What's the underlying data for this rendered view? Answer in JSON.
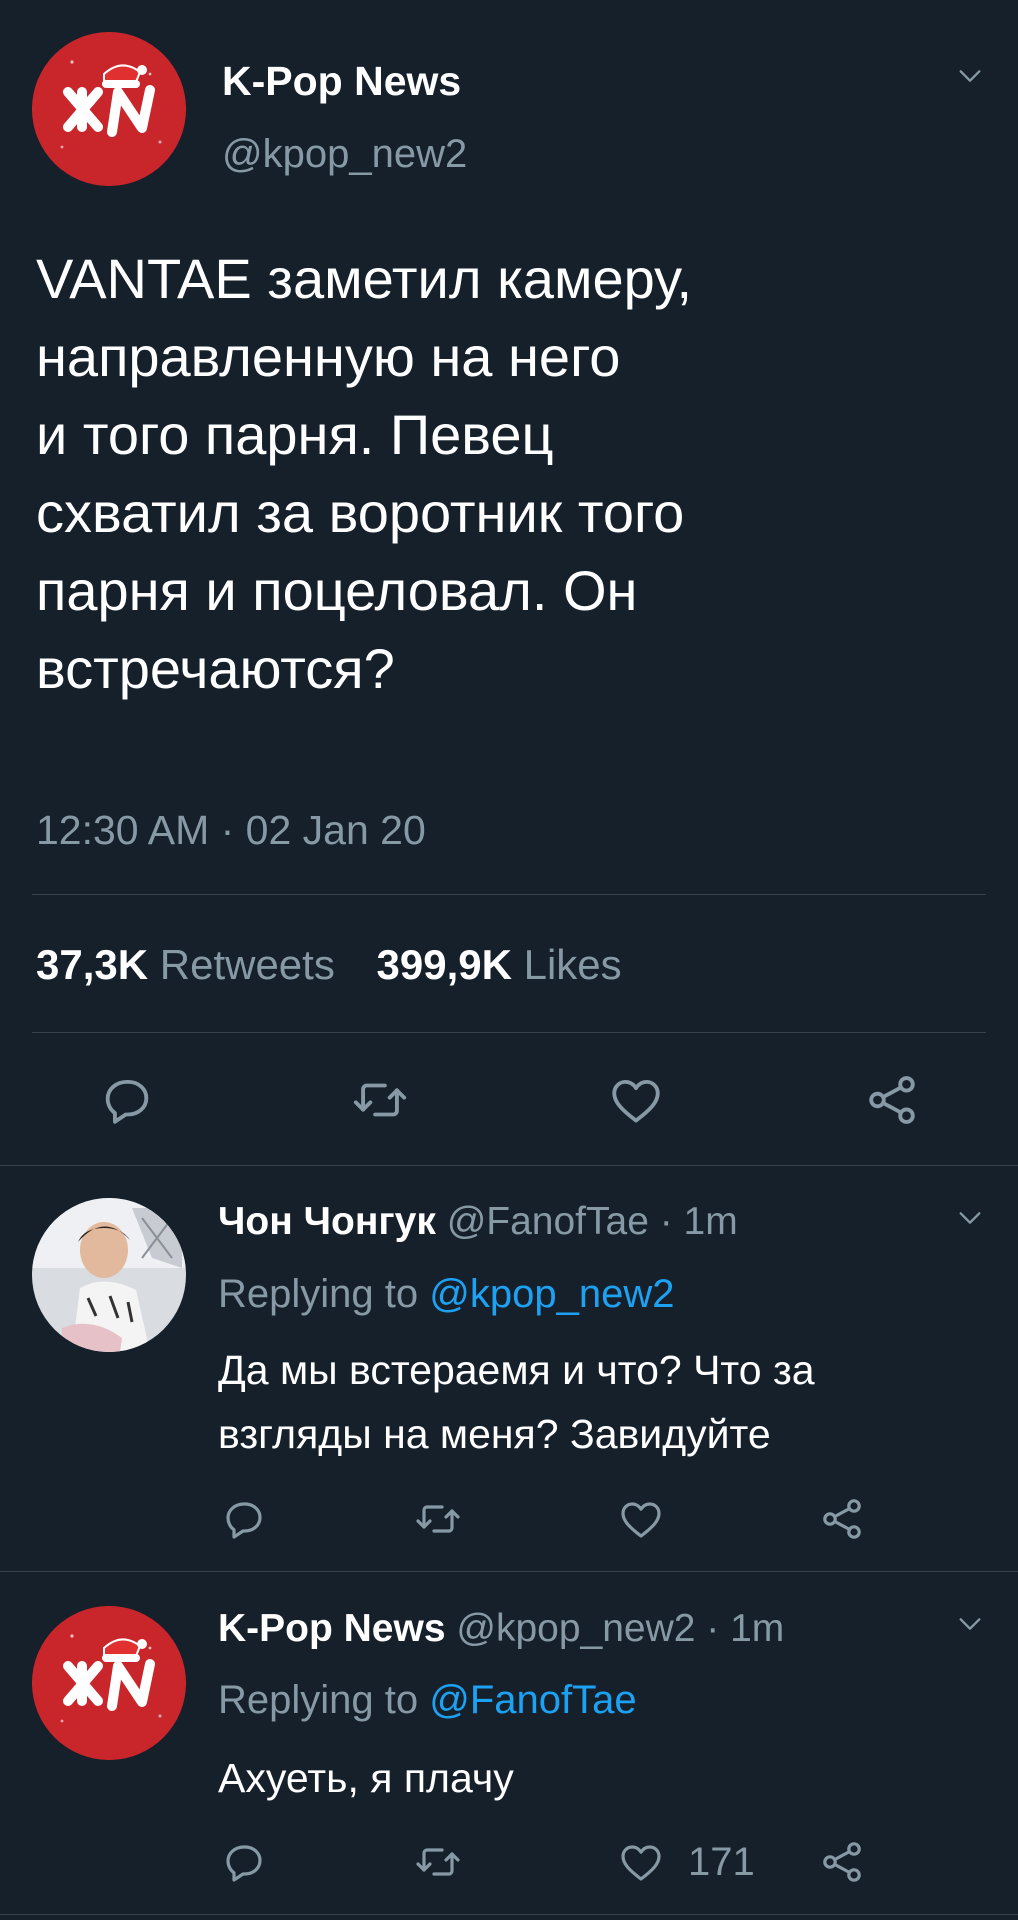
{
  "main_tweet": {
    "author_name": "K-Pop News",
    "author_handle": "@kpop_new2",
    "text_lines": [
      "VANTAE заметил камеру,",
      "направленную на него",
      "и того парня. Певец",
      "схватил за воротник того",
      "парня и поцеловал. Он",
      "встречаются?"
    ],
    "timestamp": "12:30 AM · 02 Jan 20",
    "retweets_count": "37,3K",
    "retweets_label": "Retweets",
    "likes_count": "399,9K",
    "likes_label": "Likes"
  },
  "replies": [
    {
      "author_name": "Чон Чонгук",
      "meta": "@FanofTae · 1m",
      "replying_prefix": "Replying to ",
      "replying_to": "@kpop_new2",
      "text_lines": [
        "Да мы встераемя и что? Что за",
        "взгляды на меня? Завидуйте"
      ]
    },
    {
      "author_name": "K-Pop News",
      "meta": "@kpop_new2 · 1m",
      "replying_prefix": "Replying to ",
      "replying_to": "@FanofTae",
      "text_lines": [
        "Ахуеть, я плачу"
      ],
      "like_count": "171"
    }
  ],
  "icons": [
    "reply-icon",
    "retweet-icon",
    "like-icon",
    "share-icon",
    "chevron-down-icon"
  ],
  "colors": {
    "background": "#15202b",
    "text": "#ffffff",
    "muted": "#8899a6",
    "link": "#1da1f2",
    "avatar_red": "#c9262b",
    "divider": "#38444d"
  }
}
